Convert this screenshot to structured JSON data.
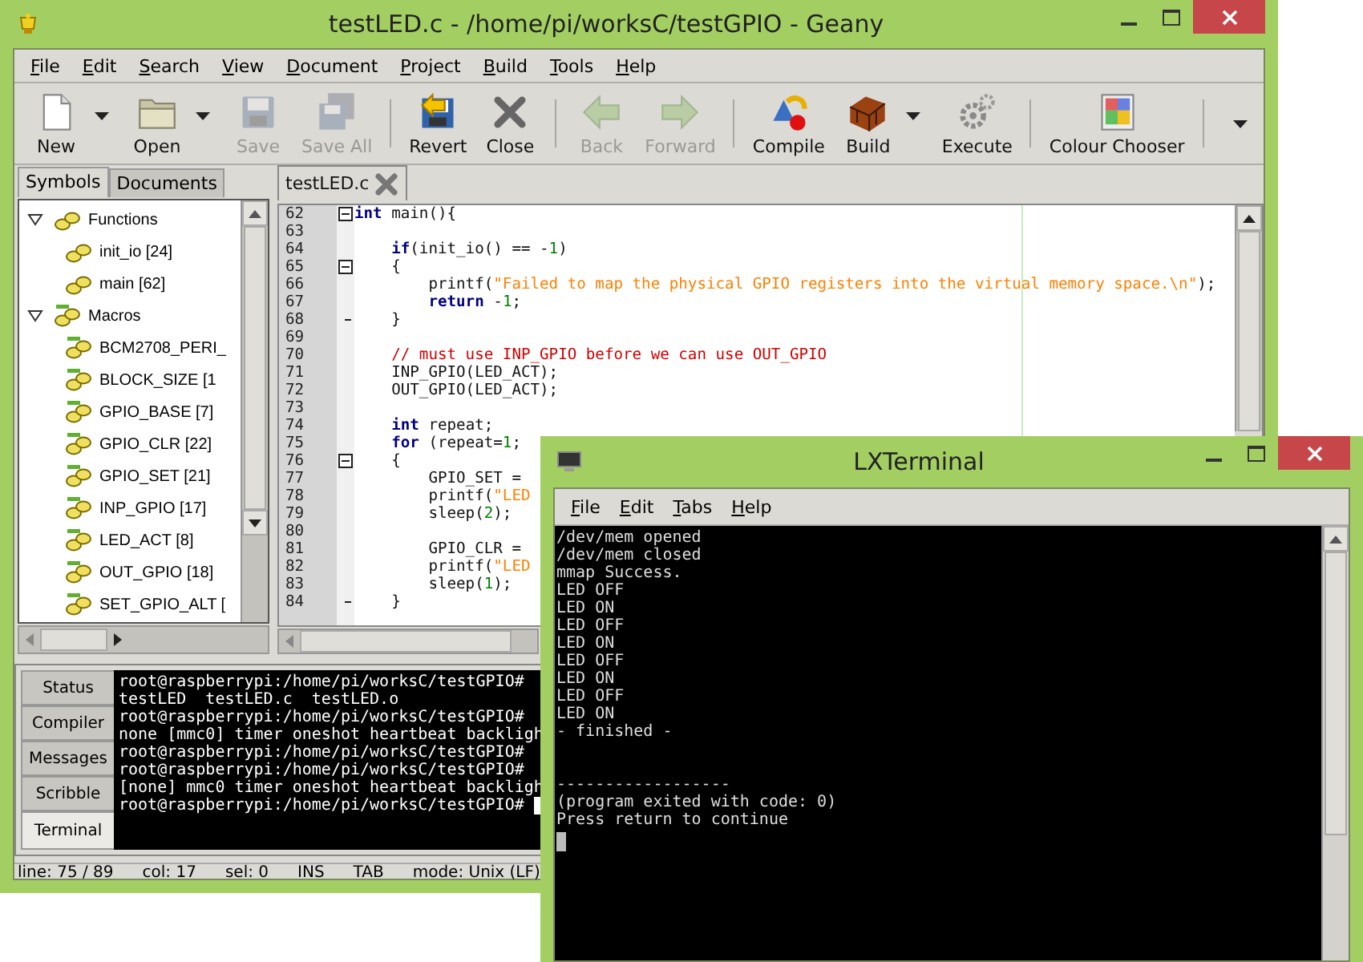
{
  "window": {
    "title": "testLED.c - /home/pi/worksC/testGPIO - Geany"
  },
  "menu": [
    "File",
    "Edit",
    "Search",
    "View",
    "Document",
    "Project",
    "Build",
    "Tools",
    "Help"
  ],
  "toolbar": {
    "items": [
      {
        "kind": "button",
        "label": "New",
        "disabled": false,
        "dropdown": true
      },
      {
        "kind": "button",
        "label": "Open",
        "disabled": false,
        "dropdown": true
      },
      {
        "kind": "button",
        "label": "Save",
        "disabled": true,
        "dropdown": false
      },
      {
        "kind": "button",
        "label": "Save All",
        "disabled": true,
        "dropdown": false
      },
      {
        "kind": "separator"
      },
      {
        "kind": "button",
        "label": "Revert",
        "disabled": false,
        "dropdown": false
      },
      {
        "kind": "button",
        "label": "Close",
        "disabled": false,
        "dropdown": false
      },
      {
        "kind": "separator"
      },
      {
        "kind": "button",
        "label": "Back",
        "disabled": true,
        "dropdown": false
      },
      {
        "kind": "button",
        "label": "Forward",
        "disabled": true,
        "dropdown": false
      },
      {
        "kind": "separator"
      },
      {
        "kind": "button",
        "label": "Compile",
        "disabled": false,
        "dropdown": false
      },
      {
        "kind": "button",
        "label": "Build",
        "disabled": false,
        "dropdown": true
      },
      {
        "kind": "button",
        "label": "Execute",
        "disabled": false,
        "dropdown": false
      },
      {
        "kind": "separator"
      },
      {
        "kind": "button",
        "label": "Colour Chooser",
        "disabled": false,
        "dropdown": false
      },
      {
        "kind": "separator"
      },
      {
        "kind": "overflow"
      }
    ]
  },
  "sidebar": {
    "tabs": [
      {
        "label": "Symbols",
        "selected": true
      },
      {
        "label": "Documents",
        "selected": false
      }
    ],
    "tree": [
      {
        "label": "Functions",
        "kind": "function",
        "expanded": true,
        "children": [
          {
            "label": "init_io [24]"
          },
          {
            "label": "main [62]"
          }
        ]
      },
      {
        "label": "Macros",
        "kind": "macro",
        "expanded": true,
        "children": [
          {
            "label": "BCM2708_PERI_"
          },
          {
            "label": "BLOCK_SIZE [1"
          },
          {
            "label": "GPIO_BASE [7]"
          },
          {
            "label": "GPIO_CLR [22]"
          },
          {
            "label": "GPIO_SET [21]"
          },
          {
            "label": "INP_GPIO [17]"
          },
          {
            "label": "LED_ACT [8]"
          },
          {
            "label": "OUT_GPIO [18]"
          },
          {
            "label": "SET_GPIO_ALT ["
          }
        ]
      }
    ]
  },
  "editor": {
    "tabs": [
      {
        "label": "testLED.c",
        "selected": true
      }
    ],
    "lines": [
      {
        "n": "62",
        "fold_start": true,
        "fold_end": false,
        "tokens": [
          {
            "kind": "keyword",
            "text": "int"
          },
          {
            "kind": "plain",
            "text": " main(){"
          }
        ]
      },
      {
        "n": "63",
        "fold_start": false,
        "fold_end": false
      },
      {
        "n": "64",
        "fold_start": false,
        "fold_end": false,
        "tokens": [
          {
            "kind": "keyword",
            "text": "    if"
          },
          {
            "kind": "plain",
            "text": "(init_io() == -"
          },
          {
            "kind": "number",
            "text": "1"
          },
          {
            "kind": "plain",
            "text": ")"
          }
        ]
      },
      {
        "n": "65",
        "fold_start": true,
        "fold_end": false,
        "tokens": [
          {
            "kind": "plain",
            "text": "    {"
          }
        ]
      },
      {
        "n": "66",
        "fold_start": false,
        "fold_end": false,
        "tokens": [
          {
            "kind": "plain",
            "text": "        printf("
          },
          {
            "kind": "string",
            "text": "\"Failed to map the physical GPIO registers into the virtual memory space.\\n\""
          },
          {
            "kind": "plain",
            "text": ");"
          }
        ]
      },
      {
        "n": "67",
        "fold_start": false,
        "fold_end": false,
        "tokens": [
          {
            "kind": "keyword",
            "text": "        return"
          },
          {
            "kind": "plain",
            "text": " -"
          },
          {
            "kind": "number",
            "text": "1"
          },
          {
            "kind": "plain",
            "text": ";"
          }
        ]
      },
      {
        "n": "68",
        "fold_start": false,
        "fold_end": true,
        "tokens": [
          {
            "kind": "plain",
            "text": "    }"
          }
        ]
      },
      {
        "n": "69",
        "fold_start": false,
        "fold_end": false
      },
      {
        "n": "70",
        "fold_start": false,
        "fold_end": false,
        "tokens": [
          {
            "kind": "comment",
            "text": "    // must use INP_GPIO before we can use OUT_GPIO"
          }
        ]
      },
      {
        "n": "71",
        "fold_start": false,
        "fold_end": false,
        "tokens": [
          {
            "kind": "plain",
            "text": "    INP_GPIO(LED_ACT);"
          }
        ]
      },
      {
        "n": "72",
        "fold_start": false,
        "fold_end": false,
        "tokens": [
          {
            "kind": "plain",
            "text": "    OUT_GPIO(LED_ACT);"
          }
        ]
      },
      {
        "n": "73",
        "fold_start": false,
        "fold_end": false
      },
      {
        "n": "74",
        "fold_start": false,
        "fold_end": false,
        "tokens": [
          {
            "kind": "keyword",
            "text": "    int"
          },
          {
            "kind": "plain",
            "text": " repeat;"
          }
        ]
      },
      {
        "n": "75",
        "fold_start": false,
        "fold_end": false,
        "tokens": [
          {
            "kind": "keyword",
            "text": "    for"
          },
          {
            "kind": "plain",
            "text": " (repeat="
          },
          {
            "kind": "number",
            "text": "1"
          },
          {
            "kind": "plain",
            "text": ";"
          }
        ]
      },
      {
        "n": "76",
        "fold_start": true,
        "fold_end": false,
        "tokens": [
          {
            "kind": "plain",
            "text": "    {"
          }
        ]
      },
      {
        "n": "77",
        "fold_start": false,
        "fold_end": false,
        "tokens": [
          {
            "kind": "plain",
            "text": "        GPIO_SET ="
          }
        ]
      },
      {
        "n": "78",
        "fold_start": false,
        "fold_end": false,
        "tokens": [
          {
            "kind": "plain",
            "text": "        printf("
          },
          {
            "kind": "string",
            "text": "\"LED"
          }
        ]
      },
      {
        "n": "79",
        "fold_start": false,
        "fold_end": false,
        "tokens": [
          {
            "kind": "plain",
            "text": "        sleep("
          },
          {
            "kind": "number",
            "text": "2"
          },
          {
            "kind": "plain",
            "text": ");"
          }
        ]
      },
      {
        "n": "80",
        "fold_start": false,
        "fold_end": false
      },
      {
        "n": "81",
        "fold_start": false,
        "fold_end": false,
        "tokens": [
          {
            "kind": "plain",
            "text": "        GPIO_CLR ="
          }
        ]
      },
      {
        "n": "82",
        "fold_start": false,
        "fold_end": false,
        "tokens": [
          {
            "kind": "plain",
            "text": "        printf("
          },
          {
            "kind": "string",
            "text": "\"LED"
          }
        ]
      },
      {
        "n": "83",
        "fold_start": false,
        "fold_end": false,
        "tokens": [
          {
            "kind": "plain",
            "text": "        sleep("
          },
          {
            "kind": "number",
            "text": "1"
          },
          {
            "kind": "plain",
            "text": ");"
          }
        ]
      },
      {
        "n": "84",
        "fold_start": false,
        "fold_end": true,
        "tokens": [
          {
            "kind": "plain",
            "text": "    }"
          }
        ]
      }
    ]
  },
  "message_window": {
    "tabs": [
      {
        "label": "Status",
        "selected": false
      },
      {
        "label": "Compiler",
        "selected": false
      },
      {
        "label": "Messages",
        "selected": false
      },
      {
        "label": "Scribble",
        "selected": false
      },
      {
        "label": "Terminal",
        "selected": true
      }
    ],
    "terminal_lines": [
      "root@raspberrypi:/home/pi/worksC/testGPIO#",
      "testLED  testLED.c  testLED.o",
      "root@raspberrypi:/home/pi/worksC/testGPIO#",
      "none [mmc0] timer oneshot heartbeat backligh",
      "root@raspberrypi:/home/pi/worksC/testGPIO#",
      "root@raspberrypi:/home/pi/worksC/testGPIO#",
      "[none] mmc0 timer oneshot heartbeat backligh",
      "root@raspberrypi:/home/pi/worksC/testGPIO#"
    ]
  },
  "status_bar": [
    "line: 75 / 89",
    "col: 17",
    "sel: 0",
    "INS",
    "TAB",
    "mode: Unix (LF)"
  ],
  "lxterminal": {
    "title": "LXTerminal",
    "menu": [
      "File",
      "Edit",
      "Tabs",
      "Help"
    ],
    "output": [
      "/dev/mem opened",
      "/dev/mem closed",
      "mmap Success.",
      "LED OFF",
      "LED ON",
      "LED OFF",
      "LED ON",
      "LED OFF",
      "LED ON",
      "LED OFF",
      "LED ON",
      "- finished -"
    ],
    "footer": [
      "------------------",
      "(program exited with code: 0)",
      "Press return to continue"
    ]
  }
}
